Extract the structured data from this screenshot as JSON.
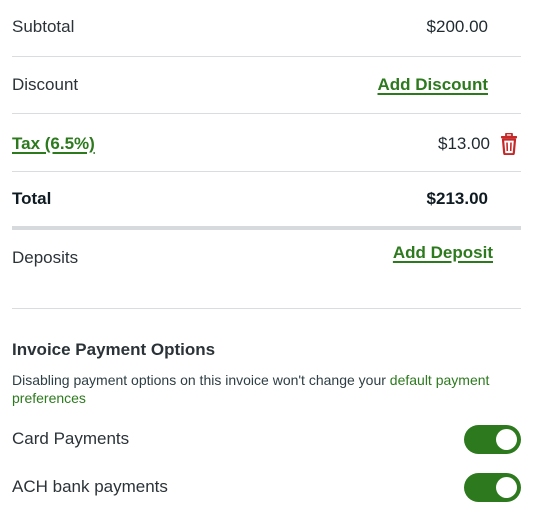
{
  "summary": {
    "subtotal_label": "Subtotal",
    "subtotal_value": "$200.00",
    "discount_label": "Discount",
    "add_discount_label": "Add Discount",
    "tax_label": "Tax (6.5%)",
    "tax_value": "$13.00",
    "total_label": "Total",
    "total_value": "$213.00",
    "deposits_label": "Deposits",
    "add_deposit_label": "Add Deposit"
  },
  "payment_options": {
    "title": "Invoice Payment Options",
    "description": "Disabling payment options on this invoice won't change your ",
    "preferences_link": "default payment preferences",
    "options": [
      {
        "label": "Card Payments",
        "enabled": true
      },
      {
        "label": "ACH bank payments",
        "enabled": true
      }
    ]
  },
  "colors": {
    "accent": "#2d7a1e",
    "delete": "#c62828"
  },
  "icons": {
    "delete": "trash-icon"
  }
}
